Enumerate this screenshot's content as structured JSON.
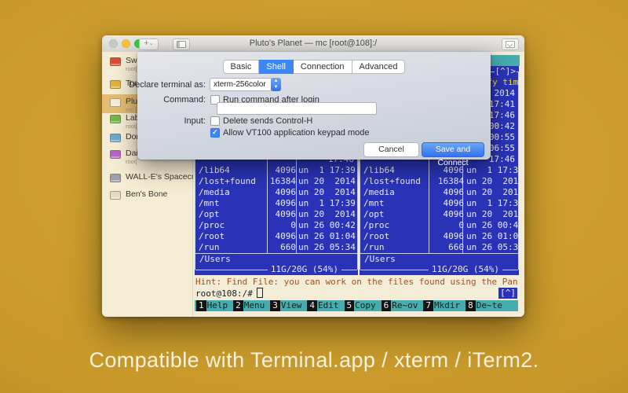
{
  "background": {
    "caption": "Compatible with Terminal.app / xterm / iTerm2.",
    "gold_color": "#c8992a"
  },
  "window": {
    "title": "Pluto's Planet — mc [root@108]:/",
    "traffic_lights": {
      "close": "#c9c7c5",
      "minimize": "#f7c13f",
      "zoom": "#34c748"
    },
    "toolbar": {
      "add_label": "+",
      "add_chevron": "⌄"
    }
  },
  "sidebar": {
    "selected_color": "#e3bc72",
    "items": [
      {
        "label": "Swif",
        "sublabel": "root[",
        "icon_color": "#dd4b32",
        "selected": false
      },
      {
        "label": "Tom",
        "sublabel": "",
        "icon_color": "#e2b33a",
        "selected": false
      },
      {
        "label": "Plut",
        "sublabel": "mc [",
        "icon_color": "#f2eede",
        "selected": true
      },
      {
        "label": "Lab",
        "sublabel": "root[",
        "icon_color": "#71b545",
        "selected": false
      },
      {
        "label": "Don",
        "sublabel": "",
        "icon_color": "#6aa8cc",
        "selected": false
      },
      {
        "label": "Dais",
        "sublabel": "root[",
        "icon_color": "#b666c4",
        "selected": false
      },
      {
        "label": "WALL-E's Spacecraft",
        "sublabel": "",
        "icon_color": "#9aa0ac",
        "selected": false
      },
      {
        "label": "Ben's Bone",
        "sublabel": "",
        "icon_color": "#e6dcc2",
        "selected": false
      }
    ]
  },
  "sheet": {
    "tabs": [
      "Basic",
      "Shell",
      "Connection",
      "Advanced"
    ],
    "active_tab": "Shell",
    "accent_color": "#3d86f6",
    "terminal_label": "Declare terminal as:",
    "terminal_value": "xterm-256color",
    "command_label": "Command:",
    "run_command_checkbox": {
      "label": "Run command after login",
      "checked": false
    },
    "command_field_value": "",
    "input_label": "Input:",
    "delete_checkbox": {
      "label": "Delete sends Control-H",
      "checked": false
    },
    "vt100_checkbox": {
      "label": "Allow VT100 application keypad mode",
      "checked": true
    },
    "cancel_label": "Cancel",
    "save_label": "Save and Connect"
  },
  "terminal": {
    "colors": {
      "panel_blue": "#2a33b8",
      "bar_teal": "#47acae",
      "bg_cream": "#f3edd7",
      "hint_brown": "#a14f24",
      "header_yellow": "#e9e348"
    },
    "corner_marker": "[^]>",
    "panel_header": {
      "name": "",
      "size": "",
      "mtime": "Modify time"
    },
    "hidden_row_times": [
      "2014",
      "17:41",
      "17:46",
      "00:42",
      "00:55",
      "06:55",
      "17:46"
    ],
    "rows": [
      {
        "name": "/lib64",
        "size": "4096",
        "date": "un  1 17:39"
      },
      {
        "name": "/lost+found",
        "size": "16384",
        "date": "un 20  2014"
      },
      {
        "name": "/media",
        "size": "4096",
        "date": "un 20  2014"
      },
      {
        "name": "/mnt",
        "size": "4096",
        "date": "un  1 17:39"
      },
      {
        "name": "/opt",
        "size": "4096",
        "date": "un 20  2014"
      },
      {
        "name": "/proc",
        "size": "0",
        "date": "un 26 00:42"
      },
      {
        "name": "/root",
        "size": "4096",
        "date": "un 26 01:04"
      },
      {
        "name": "/run",
        "size": "660",
        "date": "un 26 05:34"
      }
    ],
    "ministatus": "/Users",
    "footer": "11G/20G (54%)",
    "hint": "Hint: Find File: you can work on the files found using the Pan",
    "prompt": "root@108:/#",
    "updir_badge": "[^]",
    "fkeys": [
      {
        "key": "1",
        "label": "Help"
      },
      {
        "key": "2",
        "label": "Menu"
      },
      {
        "key": "3",
        "label": "View"
      },
      {
        "key": "4",
        "label": "Edit"
      },
      {
        "key": "5",
        "label": "Copy"
      },
      {
        "key": "6",
        "label": "Re~ov"
      },
      {
        "key": "7",
        "label": "Mkdir"
      },
      {
        "key": "8",
        "label": "De~te"
      }
    ]
  }
}
